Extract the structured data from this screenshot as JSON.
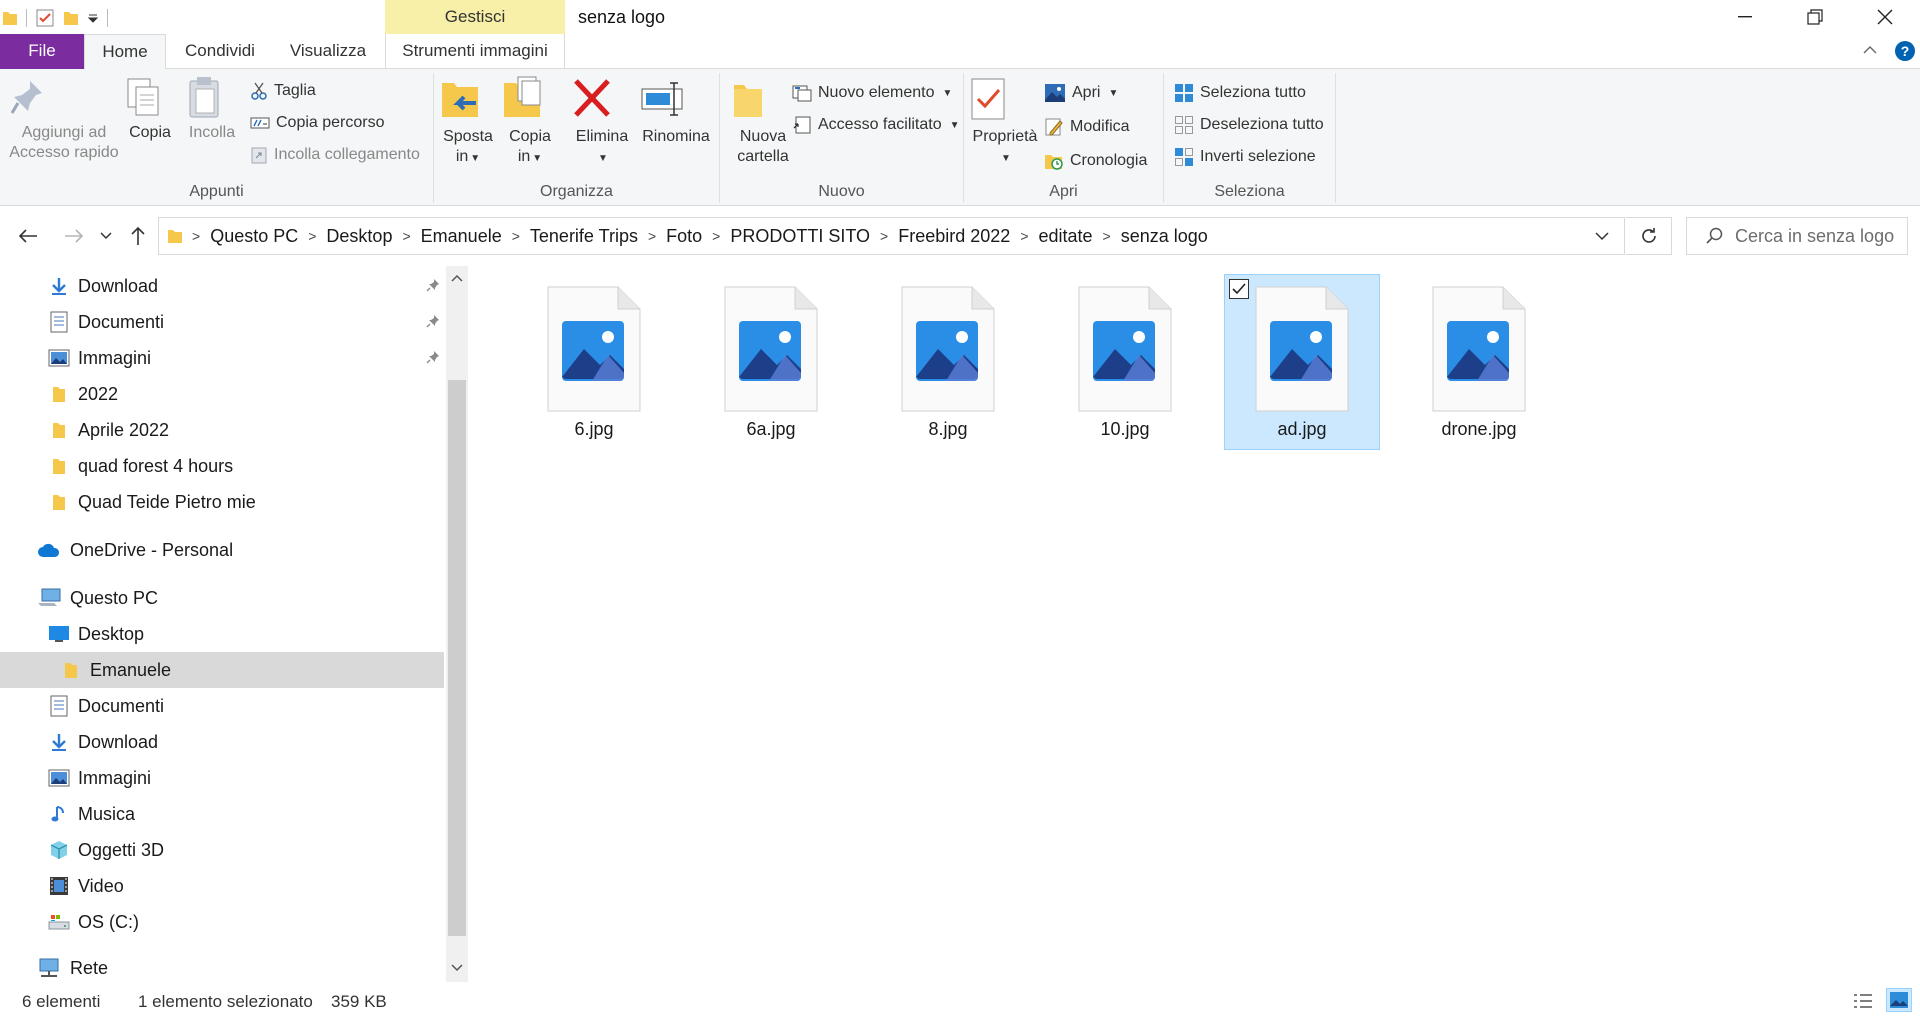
{
  "window": {
    "title": "senza logo",
    "context_tab": "Gestisci",
    "minimize_icon": "minimize-icon",
    "maximize_icon": "restore-icon",
    "close_icon": "close-icon"
  },
  "ribbon_tabs": {
    "file": "File",
    "home": "Home",
    "condividi": "Condividi",
    "visualizza": "Visualizza",
    "strumenti": "Strumenti immagini"
  },
  "ribbon": {
    "appunti": {
      "label": "Appunti",
      "pin_line1": "Aggiungi ad",
      "pin_line2": "Accesso rapido",
      "copia": "Copia",
      "incolla": "Incolla",
      "taglia": "Taglia",
      "copia_percorso": "Copia percorso",
      "incolla_collegamento": "Incolla collegamento"
    },
    "organizza": {
      "label": "Organizza",
      "sposta_line1": "Sposta",
      "sposta_line2": "in",
      "copia_in_line1": "Copia",
      "copia_in_line2": "in",
      "elimina": "Elimina",
      "rinomina": "Rinomina"
    },
    "nuovo": {
      "label": "Nuovo",
      "nuova_line1": "Nuova",
      "nuova_line2": "cartella",
      "nuovo_elemento": "Nuovo elemento",
      "accesso_facilitato": "Accesso facilitato"
    },
    "apri": {
      "label": "Apri",
      "proprieta": "Proprietà",
      "apri": "Apri",
      "modifica": "Modifica",
      "cronologia": "Cronologia"
    },
    "seleziona": {
      "label": "Seleziona",
      "seleziona_tutto": "Seleziona tutto",
      "deseleziona_tutto": "Deseleziona tutto",
      "inverti_selezione": "Inverti selezione"
    }
  },
  "address": {
    "crumbs": [
      "Questo PC",
      "Desktop",
      "Emanuele",
      "Tenerife Trips",
      "Foto",
      "PRODOTTI SITO",
      "Freebird 2022",
      "editate",
      "senza logo"
    ],
    "search_placeholder": "Cerca in senza logo"
  },
  "nav": {
    "quick_access": [
      {
        "label": "Download",
        "icon": "download-icon",
        "pinned": true
      },
      {
        "label": "Documenti",
        "icon": "documents-icon",
        "pinned": true
      },
      {
        "label": "Immagini",
        "icon": "pictures-icon",
        "pinned": true
      },
      {
        "label": "2022",
        "icon": "folder-icon",
        "pinned": false
      },
      {
        "label": "Aprile 2022",
        "icon": "folder-icon",
        "pinned": false
      },
      {
        "label": "quad forest 4 hours",
        "icon": "folder-icon",
        "pinned": false
      },
      {
        "label": "Quad Teide Pietro mie",
        "icon": "folder-icon",
        "pinned": false
      }
    ],
    "onedrive": "OneDrive - Personal",
    "questo_pc": "Questo PC",
    "pc_items": [
      {
        "label": "Desktop",
        "icon": "desktop-icon"
      },
      {
        "label": "Emanuele",
        "icon": "folder-icon",
        "selected": true
      },
      {
        "label": "Documenti",
        "icon": "documents-icon"
      },
      {
        "label": "Download",
        "icon": "download-icon"
      },
      {
        "label": "Immagini",
        "icon": "pictures-icon"
      },
      {
        "label": "Musica",
        "icon": "music-icon"
      },
      {
        "label": "Oggetti 3D",
        "icon": "objects-3d-icon"
      },
      {
        "label": "Video",
        "icon": "video-icon"
      },
      {
        "label": "OS (C:)",
        "icon": "drive-icon"
      }
    ],
    "rete": "Rete"
  },
  "files": [
    {
      "name": "6.jpg",
      "selected": false
    },
    {
      "name": "6a.jpg",
      "selected": false
    },
    {
      "name": "8.jpg",
      "selected": false
    },
    {
      "name": "10.jpg",
      "selected": false
    },
    {
      "name": "ad.jpg",
      "selected": true
    },
    {
      "name": "drone.jpg",
      "selected": false
    }
  ],
  "status": {
    "count": "6 elementi",
    "selected": "1 elemento selezionato",
    "size": "359 KB"
  },
  "colors": {
    "file_tab": "#7b2c9f",
    "context_tab": "#f8efa8",
    "selection": "#cce8ff",
    "accent": "#0078d7"
  }
}
